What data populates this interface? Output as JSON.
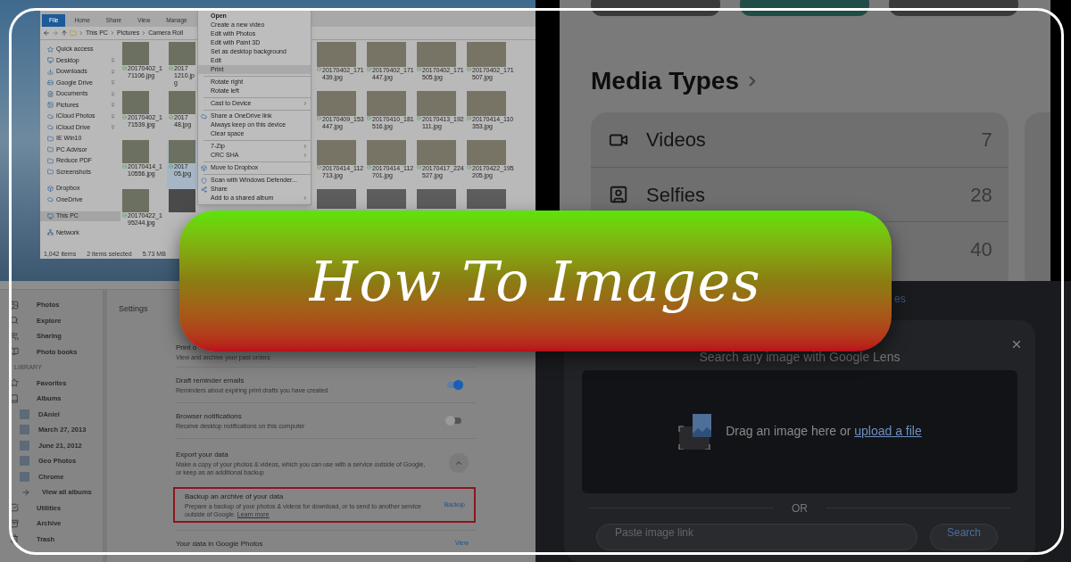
{
  "explorer": {
    "ribbon_tabs": [
      {
        "label": "File",
        "selected": true
      },
      {
        "label": "Home",
        "selected": false
      },
      {
        "label": "Share",
        "selected": false
      },
      {
        "label": "View",
        "selected": false
      },
      {
        "label": "Manage",
        "selected": false
      }
    ],
    "breadcrumb": [
      "This PC",
      "Pictures",
      "Camera Roll"
    ],
    "nav": [
      {
        "label": "Quick access",
        "pinned": false,
        "selected": false
      },
      {
        "label": "Desktop",
        "pinned": true,
        "selected": false
      },
      {
        "label": "Downloads",
        "pinned": true,
        "selected": false
      },
      {
        "label": "Google Drive",
        "pinned": true,
        "selected": false
      },
      {
        "label": "Documents",
        "pinned": true,
        "selected": false
      },
      {
        "label": "Pictures",
        "pinned": true,
        "selected": false
      },
      {
        "label": "iCloud Photos",
        "pinned": true,
        "selected": false
      },
      {
        "label": "iCloud Drive",
        "pinned": true,
        "selected": false
      },
      {
        "label": "IE Win10",
        "pinned": false,
        "selected": false
      },
      {
        "label": "PC Advisor",
        "pinned": false,
        "selected": false
      },
      {
        "label": "Reduce PDF",
        "pinned": false,
        "selected": false
      },
      {
        "label": "Screenshots",
        "pinned": false,
        "selected": false
      },
      {
        "label": "Dropbox",
        "pinned": false,
        "selected": false
      },
      {
        "label": "OneDrive",
        "pinned": false,
        "selected": false
      },
      {
        "label": "This PC",
        "pinned": false,
        "selected": true
      },
      {
        "label": "Network",
        "pinned": false,
        "selected": false
      }
    ],
    "left_thumbnails": [
      {
        "caption": "20170402_171106.jpg",
        "selected": false
      },
      {
        "caption": "2017 1210.jpg",
        "selected": false
      },
      {
        "caption": "20170402_171539.jpg",
        "selected": false
      },
      {
        "caption": "2017 48.jpg",
        "selected": false
      },
      {
        "caption": "20170414_110556.jpg",
        "selected": false
      },
      {
        "caption": "2017 05.jpg",
        "selected": true
      },
      {
        "caption": "20170422_195244.jpg",
        "selected": false
      }
    ],
    "right_thumbnails": [
      {
        "caption": "20170402_171439.jpg"
      },
      {
        "caption": "20170402_171447.jpg"
      },
      {
        "caption": "20170402_171505.jpg"
      },
      {
        "caption": "20170402_171507.jpg"
      },
      {
        "caption": "20170409_153447.jpg"
      },
      {
        "caption": "20170410_181516.jpg"
      },
      {
        "caption": "20170413_192111.jpg"
      },
      {
        "caption": "20170414_110353.jpg"
      },
      {
        "caption": "20170414_112713.jpg"
      },
      {
        "caption": "20170414_112701.jpg"
      },
      {
        "caption": "20170417_224527.jpg"
      },
      {
        "caption": "20170422_195205.jpg"
      }
    ],
    "context_menu": [
      {
        "kind": "item",
        "label": "Open",
        "default": true,
        "selected": false,
        "submenu": false
      },
      {
        "kind": "item",
        "label": "Create a new video",
        "default": false,
        "selected": false,
        "submenu": false
      },
      {
        "kind": "item",
        "label": "Edit with Photos",
        "default": false,
        "selected": false,
        "submenu": false
      },
      {
        "kind": "item",
        "label": "Edit with Paint 3D",
        "default": false,
        "selected": false,
        "submenu": false
      },
      {
        "kind": "item",
        "label": "Set as desktop background",
        "default": false,
        "selected": false,
        "submenu": false
      },
      {
        "kind": "item",
        "label": "Edit",
        "default": false,
        "selected": false,
        "submenu": false
      },
      {
        "kind": "item",
        "label": "Print",
        "default": false,
        "selected": true,
        "submenu": false
      },
      {
        "kind": "separator"
      },
      {
        "kind": "item",
        "label": "Rotate right",
        "default": false,
        "selected": false,
        "submenu": false
      },
      {
        "kind": "item",
        "label": "Rotate left",
        "default": false,
        "selected": false,
        "submenu": false
      },
      {
        "kind": "separator"
      },
      {
        "kind": "item",
        "label": "Cast to Device",
        "default": false,
        "selected": false,
        "submenu": true
      },
      {
        "kind": "separator"
      },
      {
        "kind": "icon_item",
        "label": "Share a OneDrive link",
        "default": false,
        "selected": false,
        "submenu": false
      },
      {
        "kind": "item",
        "label": "Always keep on this device",
        "default": false,
        "selected": false,
        "submenu": false
      },
      {
        "kind": "item",
        "label": "Clear space",
        "default": false,
        "selected": false,
        "submenu": false
      },
      {
        "kind": "separator"
      },
      {
        "kind": "item",
        "label": "7-Zip",
        "default": false,
        "selected": false,
        "submenu": true
      },
      {
        "kind": "item",
        "label": "CRC SHA",
        "default": false,
        "selected": false,
        "submenu": true
      },
      {
        "kind": "separator"
      },
      {
        "kind": "icon_item",
        "label": "Move to Dropbox",
        "default": false,
        "selected": false,
        "submenu": false
      },
      {
        "kind": "separator"
      },
      {
        "kind": "icon_item",
        "label": "Scan with Windows Defender...",
        "default": false,
        "selected": false,
        "submenu": false
      },
      {
        "kind": "icon_item",
        "label": "Share",
        "default": false,
        "selected": false,
        "submenu": false
      },
      {
        "kind": "item",
        "label": "Add to a shared album",
        "default": false,
        "selected": false,
        "submenu": true
      }
    ],
    "status": [
      "1,042 items",
      "2 items selected",
      "5.73 MB"
    ]
  },
  "media_types": {
    "title": "Media Types",
    "rows": [
      {
        "label": "Videos",
        "count": "7"
      },
      {
        "label": "Selfies",
        "count": "28"
      },
      {
        "label": "",
        "count": "40"
      }
    ]
  },
  "google_photos": {
    "sidebar": [
      {
        "kind": "item",
        "label": "Photos"
      },
      {
        "kind": "item",
        "label": "Explore"
      },
      {
        "kind": "item",
        "label": "Sharing"
      },
      {
        "kind": "item",
        "label": "Photo books"
      },
      {
        "kind": "section",
        "label": "LIBRARY"
      },
      {
        "kind": "item",
        "label": "Favorites"
      },
      {
        "kind": "item",
        "label": "Albums"
      },
      {
        "kind": "album",
        "label": "DAniel"
      },
      {
        "kind": "album",
        "label": "March 27, 2013"
      },
      {
        "kind": "album",
        "label": "June 21, 2012"
      },
      {
        "kind": "album",
        "label": "Geo Photos"
      },
      {
        "kind": "album",
        "label": "Chrome"
      },
      {
        "kind": "link",
        "label": "View all albums"
      },
      {
        "kind": "item",
        "label": "Utilities"
      },
      {
        "kind": "item",
        "label": "Archive"
      },
      {
        "kind": "item",
        "label": "Trash"
      }
    ],
    "heading": "Settings",
    "settings": [
      {
        "kind": "partial",
        "title": "Print o",
        "subtitle": "View and archive your past orders"
      },
      {
        "kind": "toggle",
        "title": "Draft reminder emails",
        "subtitle": "Reminders about expiring print drafts you have created",
        "on": true
      },
      {
        "kind": "toggle",
        "title": "Browser notifications",
        "subtitle": "Receive desktop notifications on this computer",
        "on": false
      },
      {
        "kind": "expand",
        "title": "Export your data",
        "subtitle": "Make a copy of your photos & videos, which you can use with a service outside of Google, or keep as an additional backup",
        "expanded": true
      },
      {
        "kind": "highlight",
        "title": "Backup an archive of your data",
        "subtitle": "Prepare a backup of your photos & videos for download, or to send to another service outside of Google.",
        "link": "Learn more",
        "action": "Backup"
      },
      {
        "kind": "action",
        "title": "Your data in Google Photos",
        "action": "View"
      }
    ]
  },
  "lens": {
    "link_fragment": "es",
    "title": "Search any image with Google Lens",
    "drop_text": "Drag an image here or",
    "upload_link": "upload a file",
    "divider": "OR",
    "url_placeholder": "Paste image link",
    "search_button": "Search"
  },
  "banner": {
    "title": "How To Images"
  }
}
